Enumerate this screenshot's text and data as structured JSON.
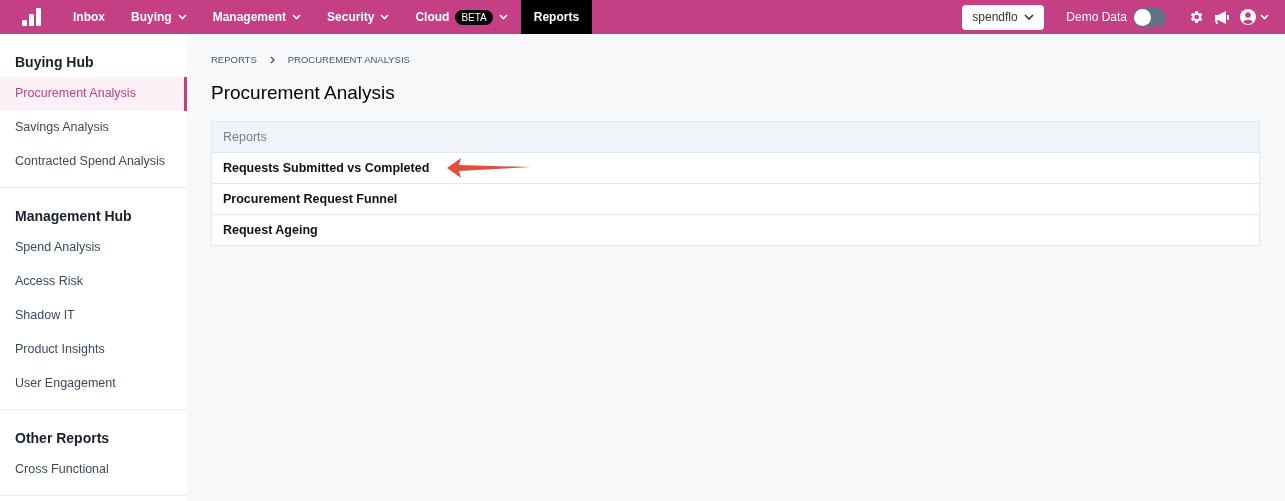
{
  "nav": {
    "items": [
      {
        "label": "Inbox",
        "dropdown": false,
        "selected": false
      },
      {
        "label": "Buying",
        "dropdown": true,
        "selected": false
      },
      {
        "label": "Management",
        "dropdown": true,
        "selected": false
      },
      {
        "label": "Security",
        "dropdown": true,
        "selected": false
      },
      {
        "label": "Cloud",
        "badge": "BETA",
        "dropdown": true,
        "selected": false
      },
      {
        "label": "Reports",
        "dropdown": false,
        "selected": true
      }
    ],
    "org_select": {
      "value": "spendflo"
    },
    "demo_toggle": {
      "label": "Demo Data",
      "on": false
    }
  },
  "sidebar": {
    "sections": [
      {
        "title": "Buying Hub",
        "items": [
          {
            "label": "Procurement Analysis",
            "selected": true
          },
          {
            "label": "Savings Analysis",
            "selected": false
          },
          {
            "label": "Contracted Spend Analysis",
            "selected": false
          }
        ]
      },
      {
        "title": "Management Hub",
        "items": [
          {
            "label": "Spend Analysis",
            "selected": false
          },
          {
            "label": "Access Risk",
            "selected": false
          },
          {
            "label": "Shadow IT",
            "selected": false
          },
          {
            "label": "Product Insights",
            "selected": false
          },
          {
            "label": "User Engagement",
            "selected": false
          }
        ]
      },
      {
        "title": "Other Reports",
        "items": [
          {
            "label": "Cross Functional",
            "selected": false
          }
        ]
      }
    ]
  },
  "breadcrumb": [
    "REPORTS",
    "PROCUREMENT ANALYSIS"
  ],
  "page_title": "Procurement Analysis",
  "table": {
    "header": "Reports",
    "rows": [
      "Requests Submitted vs Completed",
      "Procurement Request Funnel",
      "Request Ageing"
    ]
  }
}
